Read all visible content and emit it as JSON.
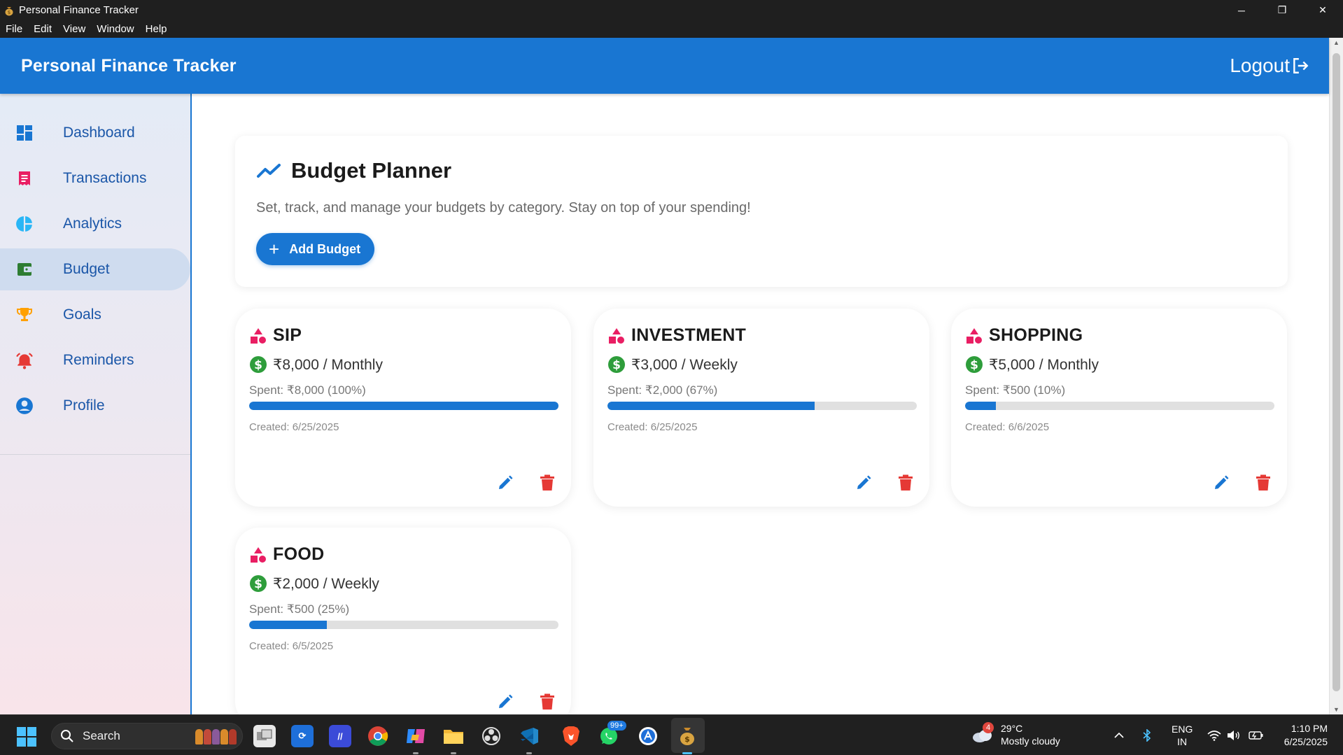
{
  "window": {
    "title": "Personal Finance Tracker",
    "controls": [
      "─",
      "❐",
      "✕"
    ]
  },
  "menu": [
    "File",
    "Edit",
    "View",
    "Window",
    "Help"
  ],
  "header": {
    "brand": "Personal Finance Tracker",
    "logout_label": "Logout",
    "color": "#1976d2"
  },
  "sidebar": {
    "items": [
      {
        "label": "Dashboard",
        "icon": "dashboard-icon",
        "color": "#1976d2"
      },
      {
        "label": "Transactions",
        "icon": "receipt-icon",
        "color": "#e91e63"
      },
      {
        "label": "Analytics",
        "icon": "pie-chart-icon",
        "color": "#29b6f6"
      },
      {
        "label": "Budget",
        "icon": "wallet-icon",
        "color": "#2e7d32",
        "active": true
      },
      {
        "label": "Goals",
        "icon": "trophy-icon",
        "color": "#ffa000"
      },
      {
        "label": "Reminders",
        "icon": "alarm-icon",
        "color": "#e53935"
      },
      {
        "label": "Profile",
        "icon": "account-circle-icon",
        "color": "#1976d2"
      }
    ]
  },
  "planner": {
    "title": "Budget Planner",
    "subtitle": "Set, track, and manage your budgets by category. Stay on top of your spending!",
    "add_label": "Add Budget"
  },
  "budgets": [
    {
      "name": "SIP",
      "amount": "₹8,000 / Monthly",
      "spent": "Spent: ₹8,000 (100%)",
      "progress": 100,
      "created": "Created: 6/25/2025"
    },
    {
      "name": "INVESTMENT",
      "amount": "₹3,000 / Weekly",
      "spent": "Spent: ₹2,000 (67%)",
      "progress": 67,
      "created": "Created: 6/25/2025"
    },
    {
      "name": "SHOPPING",
      "amount": "₹5,000 / Monthly",
      "spent": "Spent: ₹500 (10%)",
      "progress": 10,
      "created": "Created: 6/6/2025"
    },
    {
      "name": "FOOD",
      "amount": "₹2,000 / Weekly",
      "spent": "Spent: ₹500 (25%)",
      "progress": 25,
      "created": "Created: 6/5/2025"
    }
  ],
  "taskbar": {
    "search_label": "Search",
    "whatsapp_badge": "99+",
    "weather": {
      "badge": "4",
      "temp": "29°C",
      "condition": "Mostly cloudy"
    },
    "lang": {
      "line1": "ENG",
      "line2": "IN"
    },
    "time": "1:10 PM",
    "date": "6/25/2025"
  }
}
